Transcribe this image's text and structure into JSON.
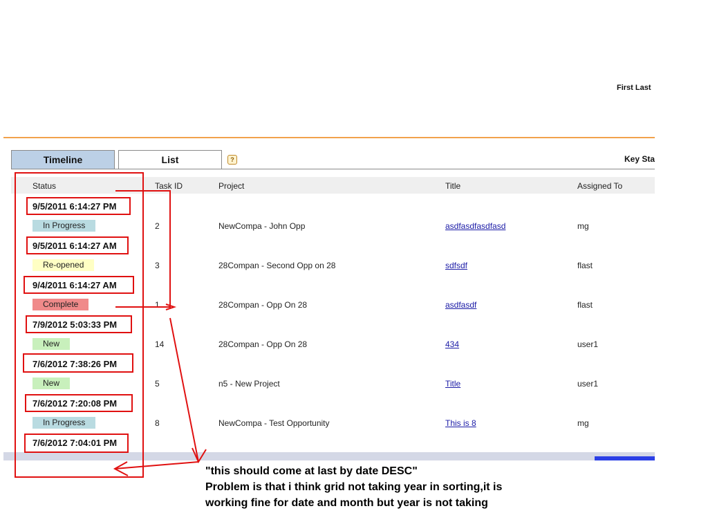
{
  "header": {
    "user_name": "First Last"
  },
  "tabs": {
    "timeline": "Timeline",
    "list": "List",
    "help_icon": "?"
  },
  "key_stat_label": "Key Sta",
  "columns": [
    "Status",
    "Task ID",
    "Project",
    "Title",
    "Assigned To"
  ],
  "groups": [
    {
      "date": "9/5/2011 6:14:27 PM",
      "status": "In Progress",
      "status_color": "#b9dbe1",
      "task_id": "2",
      "project": "NewCompa - John Opp",
      "title": "asdfasdfasdfasd",
      "assigned_to": "mg"
    },
    {
      "date": "9/5/2011 6:14:27 AM",
      "status": "Re-opened",
      "status_color": "#ffffc4",
      "task_id": "3",
      "project": "28Compan - Second Opp on 28",
      "title": "sdfsdf",
      "assigned_to": "flast"
    },
    {
      "date": "9/4/2011 6:14:27 AM",
      "status": "Complete",
      "status_color": "#f08a8a",
      "task_id": "1",
      "project": "28Compan - Opp On 28",
      "title": "asdfasdf",
      "assigned_to": "flast"
    },
    {
      "date": "7/9/2012 5:03:33 PM",
      "status": "New",
      "status_color": "#c8f0bc",
      "task_id": "14",
      "project": "28Compan - Opp On 28",
      "title": "434",
      "assigned_to": "user1"
    },
    {
      "date": "7/6/2012 7:38:26 PM",
      "status": "New",
      "status_color": "#c8f0bc",
      "task_id": "5",
      "project": "n5 - New Project",
      "title": "Title",
      "assigned_to": "user1"
    },
    {
      "date": "7/6/2012 7:20:08 PM",
      "status": "In Progress",
      "status_color": "#b9dbe1",
      "task_id": "8",
      "project": "NewCompa - Test Opportunity",
      "title": "This is 8",
      "assigned_to": "mg"
    }
  ],
  "last_date": "7/6/2012 7:04:01 PM",
  "annotation": {
    "line1": "\"this should come at last by date DESC\"",
    "line2": "Problem is that i think grid  not taking    year in sorting,it is",
    "line3": "working fine for date and month but year is not taking"
  },
  "colors": {
    "accent_orange": "#f2a24b",
    "tab_active": "#bcd0e6",
    "annotation_red": "#e01010",
    "scroll_thumb": "#2b3fe6"
  }
}
